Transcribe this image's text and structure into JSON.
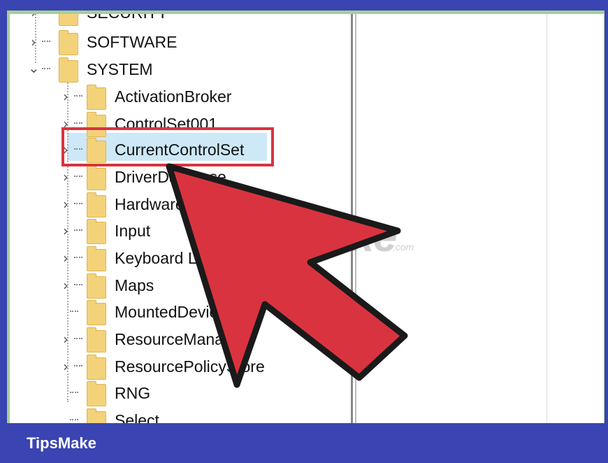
{
  "tree": {
    "items": [
      {
        "label": "SECURITY",
        "expander": "chevron-right",
        "level": 0
      },
      {
        "label": "SOFTWARE",
        "expander": "chevron-right",
        "level": 0
      },
      {
        "label": "SYSTEM",
        "expander": "chevron-down",
        "level": 0
      },
      {
        "label": "ActivationBroker",
        "expander": "chevron-right",
        "level": 1
      },
      {
        "label": "ControlSet001",
        "expander": "chevron-right",
        "level": 1
      },
      {
        "label": "CurrentControlSet",
        "expander": "chevron-right",
        "level": 1,
        "selected": true
      },
      {
        "label": "DriverDatabase",
        "expander": "chevron-right",
        "level": 1
      },
      {
        "label": "HardwareConfig",
        "expander": "chevron-right",
        "level": 1
      },
      {
        "label": "Input",
        "expander": "chevron-right",
        "level": 1
      },
      {
        "label": "Keyboard Layout",
        "expander": "chevron-right",
        "level": 1
      },
      {
        "label": "Maps",
        "expander": "chevron-right",
        "level": 1
      },
      {
        "label": "MountedDevices",
        "expander": "none",
        "level": 1
      },
      {
        "label": "ResourceManager",
        "expander": "chevron-right",
        "level": 1
      },
      {
        "label": "ResourcePolicyStore",
        "expander": "chevron-right",
        "level": 1
      },
      {
        "label": "RNG",
        "expander": "none",
        "level": 1
      },
      {
        "label": "Select",
        "expander": "none",
        "level": 1
      }
    ]
  },
  "watermark": {
    "text": "TipsMake",
    "suffix": ".com"
  },
  "footer": {
    "brand": "TipsMake"
  },
  "colors": {
    "highlight_border": "#d93340",
    "arrow": "#d93340",
    "selection": "#cde8f7",
    "brand_bar": "#3a44b2"
  }
}
